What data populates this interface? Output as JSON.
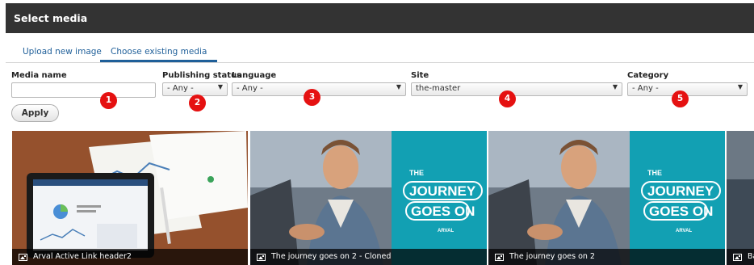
{
  "dialog": {
    "title": "Select media"
  },
  "tabs": [
    {
      "label": "Upload new image"
    },
    {
      "label": "Choose existing media"
    }
  ],
  "filters": {
    "media_name": {
      "label": "Media name",
      "value": ""
    },
    "publishing_status": {
      "label": "Publishing status",
      "value": "- Any -"
    },
    "language": {
      "label": "Language",
      "value": "- Any -"
    },
    "site": {
      "label": "Site",
      "value": "the-master"
    },
    "category": {
      "label": "Category",
      "value": "- Any -"
    }
  },
  "badges": [
    "1",
    "2",
    "3",
    "4",
    "5"
  ],
  "apply_label": "Apply",
  "media": [
    {
      "caption": "Arval Active Link header2"
    },
    {
      "caption": "The journey goes on 2 - Cloned"
    },
    {
      "caption": "The journey goes on 2"
    },
    {
      "caption": "Ba"
    }
  ],
  "journey_tile": {
    "line1": "THE",
    "line2": "JOURNEY",
    "line3": "GOES ON",
    "brand": "ARVAL"
  },
  "colors": {
    "header_bg": "#333333",
    "tab_accent": "#1f5f99",
    "badge": "#e51111",
    "teal": "#12a0b3"
  }
}
